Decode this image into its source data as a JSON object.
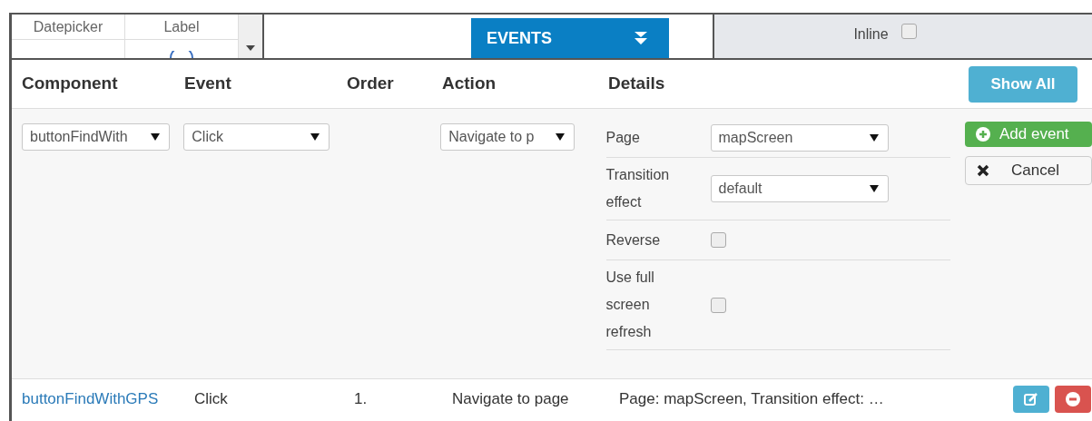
{
  "palette": {
    "cells": [
      "Datepicker",
      "Label"
    ]
  },
  "events_tab": {
    "label": "EVENTS"
  },
  "properties_strip": {
    "inline": {
      "label": "Inline",
      "checked": false
    }
  },
  "columns": [
    "Component",
    "Event",
    "Order",
    "Action",
    "Details"
  ],
  "show_all_button": "Show All",
  "editor": {
    "component": "buttonFindWith",
    "event": "Click",
    "action": "Navigate to p",
    "details": [
      {
        "kind": "select",
        "label": "Page",
        "value": "mapScreen"
      },
      {
        "kind": "select",
        "label": "Transition effect",
        "value": "default"
      },
      {
        "kind": "checkbox",
        "label": "Reverse",
        "checked": false
      },
      {
        "kind": "checkbox",
        "label": "Use full screen refresh",
        "checked": false
      }
    ],
    "add_button": "Add event",
    "cancel_button": "Cancel"
  },
  "events": [
    {
      "component": "buttonFindWithGPS",
      "event": "Click",
      "order": "1.",
      "action": "Navigate to page",
      "details": "Page: mapScreen, Transition effect: …"
    }
  ]
}
